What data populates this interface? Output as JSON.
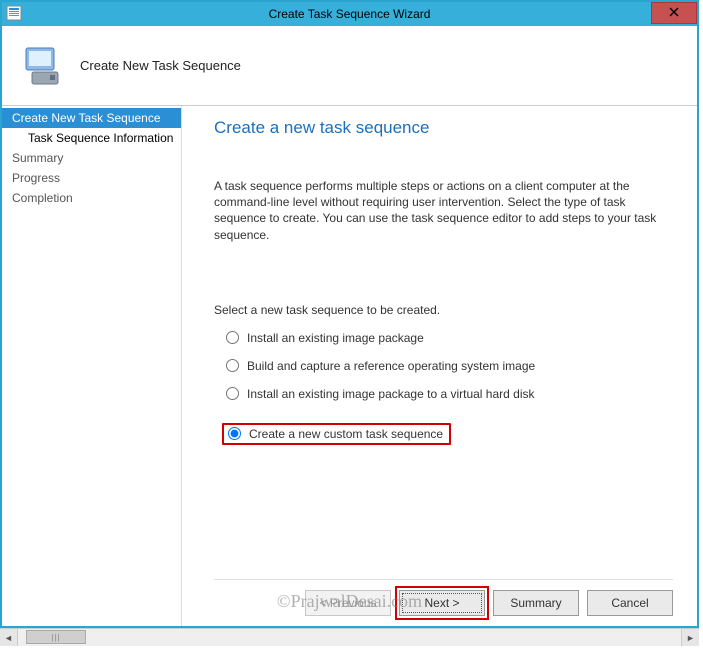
{
  "window": {
    "title": "Create Task Sequence Wizard"
  },
  "header": {
    "title": "Create New Task Sequence"
  },
  "sidebar": {
    "steps": [
      {
        "label": "Create New Task Sequence"
      },
      {
        "label": "Task Sequence Information"
      },
      {
        "label": "Summary"
      },
      {
        "label": "Progress"
      },
      {
        "label": "Completion"
      }
    ]
  },
  "main": {
    "page_title": "Create a new task sequence",
    "description": "A task sequence performs multiple steps or actions on a client computer at the command-line level without requiring user intervention. Select the type of task sequence to create. You can use the task sequence editor to add steps to your task sequence.",
    "select_label": "Select a new task sequence to be created.",
    "options": [
      {
        "label": "Install an existing image package"
      },
      {
        "label": "Build and capture a reference operating system image"
      },
      {
        "label": "Install an existing image package to a virtual hard disk"
      },
      {
        "label": "Create a new custom task sequence"
      }
    ]
  },
  "buttons": {
    "previous": "< Previous",
    "next": "Next >",
    "summary": "Summary",
    "cancel": "Cancel"
  },
  "scrollbar": {
    "left_glyph": "◄",
    "right_glyph": "►",
    "thumb_glyph": "|||"
  },
  "watermark": "©PrajwalDesai.com"
}
